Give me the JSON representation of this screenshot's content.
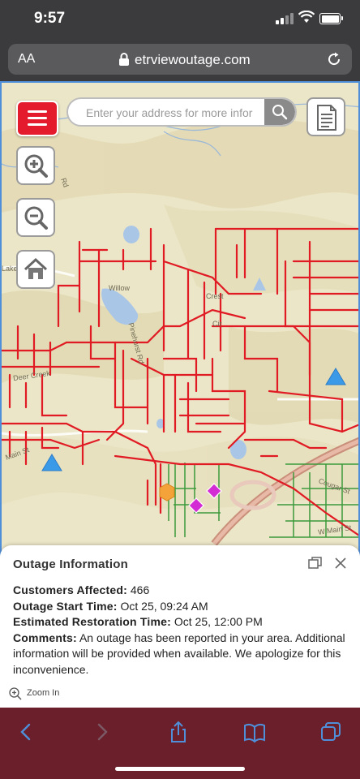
{
  "status_bar": {
    "time": "9:57"
  },
  "browser": {
    "text_size": "AA",
    "url": "etrviewoutage.com"
  },
  "map": {
    "search_placeholder": "Enter your address for more infor",
    "labels": [
      {
        "text": "Rd"
      },
      {
        "text": "Willow"
      },
      {
        "text": "Crest"
      },
      {
        "text": "Cir"
      },
      {
        "text": "Deer Creek"
      },
      {
        "text": "Main St"
      },
      {
        "text": "Lake"
      },
      {
        "text": "W Main St"
      },
      {
        "text": "Cougar St"
      },
      {
        "text": "Pinehurst Rd"
      }
    ]
  },
  "popup": {
    "title": "Outage Information",
    "customers_label": "Customers Affected:",
    "customers_value": "466",
    "start_label": "Outage Start Time:",
    "start_value": "Oct 25, 09:24 AM",
    "restore_label": "Estimated Restoration Time:",
    "restore_value": "Oct 25, 12:00 PM",
    "comments_label": "Comments:",
    "comments_value": "An outage has been reported in your area. Additional information will be provided when available. We apologize for this inconvenience.",
    "zoom_in": "Zoom In"
  },
  "colors": {
    "outage_lines": "#e01b24",
    "unaffected_lines": "#3c9a3c",
    "menu_button": "#e31b2d",
    "toolbar": "#6b1f2a",
    "link_blue": "#4f8ed8"
  },
  "icons": [
    "lock-icon",
    "reload-icon",
    "menu-icon",
    "search-icon",
    "document-icon",
    "zoom-in-icon",
    "zoom-out-icon",
    "home-icon",
    "dock-icon",
    "close-icon",
    "back-icon",
    "forward-icon",
    "share-icon",
    "bookmarks-icon",
    "tabs-icon"
  ]
}
